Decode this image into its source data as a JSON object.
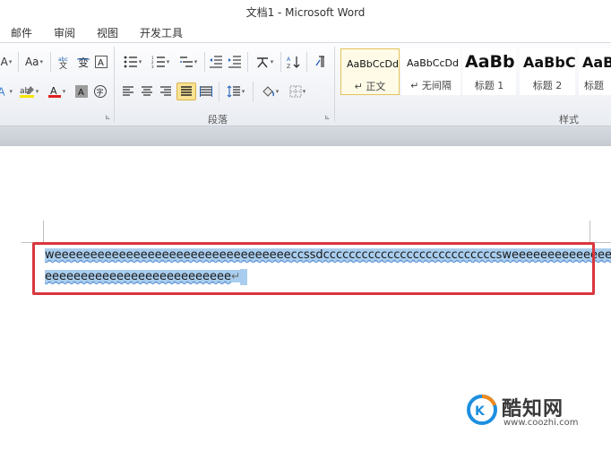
{
  "window": {
    "title": "文档1 - Microsoft Word"
  },
  "tabs": [
    {
      "label": "邮件"
    },
    {
      "label": "审阅"
    },
    {
      "label": "视图"
    },
    {
      "label": "开发工具"
    }
  ],
  "ribbon": {
    "font_group": {
      "change_case_label": "Aa",
      "font_size_partial": "A",
      "font_color": "#e02020",
      "highlight_color": "#f6e500"
    },
    "paragraph_group": {
      "label": "段落"
    },
    "styles_group": {
      "label": "样式",
      "styles": [
        {
          "sample": "AaBbCcDd",
          "name": "正文",
          "prefix": "↵",
          "selected": true
        },
        {
          "sample": "AaBbCcDd",
          "name": "无间隔",
          "prefix": "↵",
          "selected": false
        },
        {
          "sample": "AaBb",
          "name": "标题 1",
          "prefix": "",
          "selected": false
        },
        {
          "sample": "AaBbC",
          "name": "标题 2",
          "prefix": "",
          "selected": false
        },
        {
          "sample": "AaBl",
          "name": "标题",
          "prefix": "",
          "selected": false
        }
      ]
    }
  },
  "document": {
    "lines": [
      "weeeeeeeeeeeeeeeeeeeeeeeeeeeeeeeeeccssdcccccccccccccccccccccccccccsweeeeeeeeeeeeeeeee",
      "eeeeeeeeeeeeeeeeeeeeeeeeee"
    ],
    "paragraph_mark": "↵",
    "selection_color": "#a9cdee",
    "highlight_box_color": "#d9363e"
  },
  "watermark": {
    "brand": "酷知网",
    "url": "www.coozhi.com"
  }
}
